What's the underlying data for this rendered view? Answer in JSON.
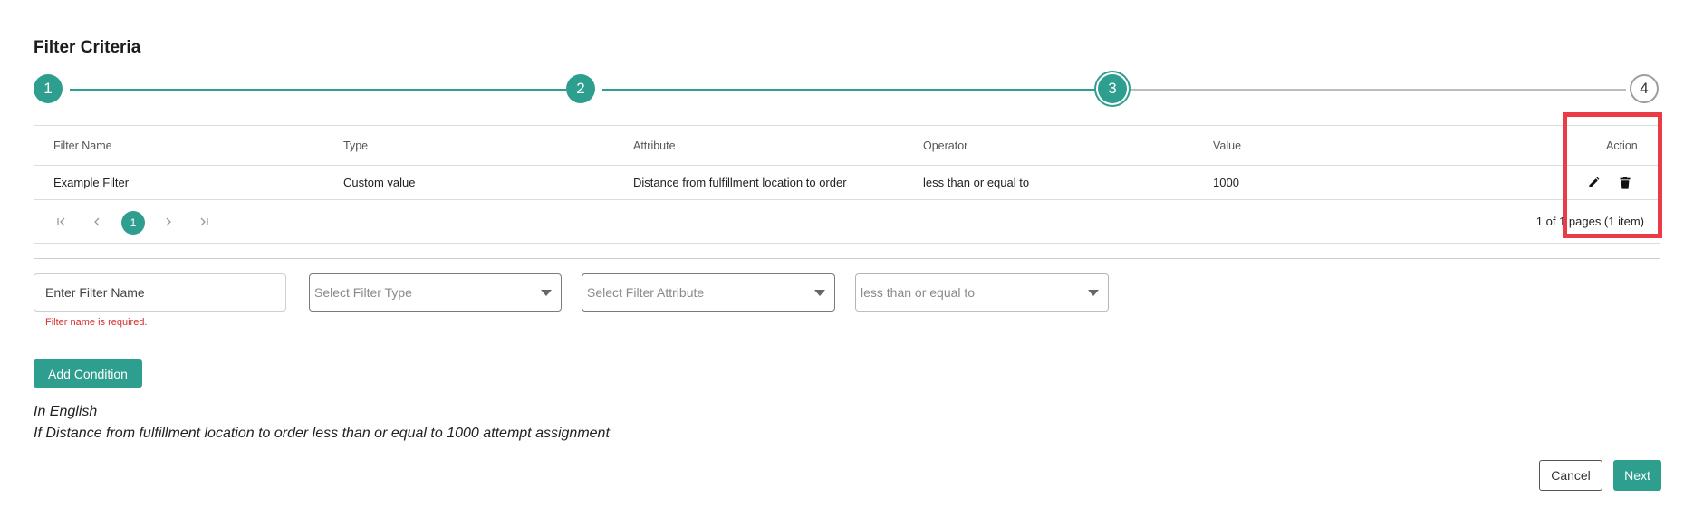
{
  "page": {
    "title": "Filter Criteria"
  },
  "stepper": {
    "steps": [
      {
        "label": "1",
        "state": "completed"
      },
      {
        "label": "2",
        "state": "completed"
      },
      {
        "label": "3",
        "state": "current"
      },
      {
        "label": "4",
        "state": "pending"
      }
    ]
  },
  "grid": {
    "columns": [
      "Filter Name",
      "Type",
      "Attribute",
      "Operator",
      "Value",
      "Action"
    ],
    "rows": [
      {
        "filter_name": "Example Filter",
        "type": "Custom value",
        "attribute": "Distance from fulfillment location to order",
        "operator": "less than or equal to",
        "value": "1000",
        "actions": [
          "pencil-icon",
          "trash-icon"
        ]
      }
    ],
    "pager": {
      "first": "|<",
      "prev": "<",
      "current_page": "1",
      "next": ">",
      "last": ">|",
      "info": "1 of 1 pages (1 item)"
    }
  },
  "form": {
    "filter_name": {
      "value": "",
      "placeholder": "Enter Filter Name",
      "error": "Filter name is required."
    },
    "filter_type": {
      "placeholder": "Select Filter Type"
    },
    "filter_attribute": {
      "placeholder": "Select Filter Attribute"
    },
    "operator": {
      "value": "less than or equal to"
    },
    "add_condition_label": "Add Condition"
  },
  "summary": {
    "heading": "In English",
    "text": "If Distance from fulfillment location to order less than or equal to 1000 attempt assignment"
  },
  "footer": {
    "cancel_label": "Cancel",
    "next_label": "Next"
  },
  "colors": {
    "accent": "#2e9e8f",
    "highlight": "#ea3b46",
    "error": "#d32f2f"
  }
}
